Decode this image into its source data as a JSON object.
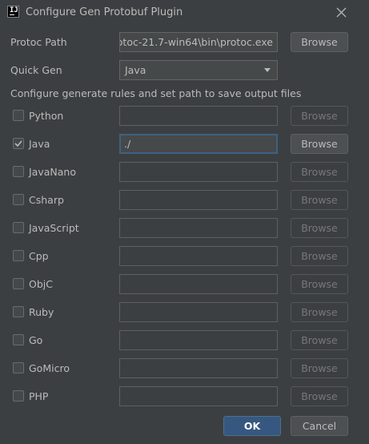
{
  "window": {
    "title": "Configure Gen Protobuf Plugin",
    "app_icon": "intellij-icon",
    "close_icon": "close-icon"
  },
  "protoc": {
    "label": "Protoc Path",
    "value": "rotoc-21.7-win64\\bin\\protoc.exe",
    "browse": "Browse"
  },
  "quick_gen": {
    "label": "Quick Gen",
    "selected": "Java"
  },
  "section_label": "Configure generate rules and set path to save output files",
  "languages": [
    {
      "name": "Python",
      "checked": false,
      "path": "",
      "browse": "Browse",
      "enabled": false
    },
    {
      "name": "Java",
      "checked": true,
      "path": "./",
      "browse": "Browse",
      "enabled": true
    },
    {
      "name": "JavaNano",
      "checked": false,
      "path": "",
      "browse": "Browse",
      "enabled": false
    },
    {
      "name": "Csharp",
      "checked": false,
      "path": "",
      "browse": "Browse",
      "enabled": false
    },
    {
      "name": "JavaScript",
      "checked": false,
      "path": "",
      "browse": "Browse",
      "enabled": false
    },
    {
      "name": "Cpp",
      "checked": false,
      "path": "",
      "browse": "Browse",
      "enabled": false
    },
    {
      "name": "ObjC",
      "checked": false,
      "path": "",
      "browse": "Browse",
      "enabled": false
    },
    {
      "name": "Ruby",
      "checked": false,
      "path": "",
      "browse": "Browse",
      "enabled": false
    },
    {
      "name": "Go",
      "checked": false,
      "path": "",
      "browse": "Browse",
      "enabled": false
    },
    {
      "name": "GoMicro",
      "checked": false,
      "path": "",
      "browse": "Browse",
      "enabled": false
    },
    {
      "name": "PHP",
      "checked": false,
      "path": "",
      "browse": "Browse",
      "enabled": false
    }
  ],
  "footer": {
    "ok": "OK",
    "cancel": "Cancel"
  },
  "colors": {
    "background": "#3c3f41",
    "accent": "#365880",
    "focus_border": "#3d6185",
    "text": "#bbbbbb",
    "disabled_text": "#777777"
  }
}
